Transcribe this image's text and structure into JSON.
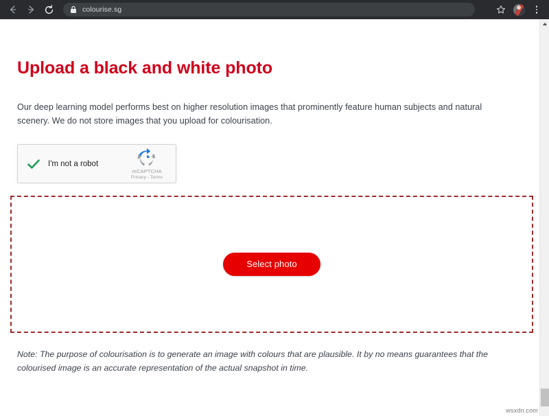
{
  "browser": {
    "back_label": "Back",
    "forward_label": "Forward",
    "reload_label": "Reload",
    "url": "colourise.sg",
    "lock_icon": "lock-icon",
    "bookmark_label": "Bookmark this tab",
    "profile_label": "Profile",
    "menu_label": "Customise and control Google Chrome"
  },
  "page": {
    "title": "Upload a black and white photo",
    "intro": "Our deep learning model performs best on higher resolution images that prominently feature human subjects and natural scenery. We do not store images that you upload for colourisation.",
    "note": "Note: The purpose of colourisation is to generate an image with colours that are plausible. It by no means guarantees that the colourised image is an accurate representation of the actual snapshot in time."
  },
  "recaptcha": {
    "label": "I'm not a robot",
    "brand": "reCAPTCHA",
    "links": "Privacy - Terms",
    "checked": true
  },
  "dropzone": {
    "button_label": "Select photo"
  },
  "watermark": {
    "text": "wsxdn.com"
  },
  "colors": {
    "heading_red": "#d0021b",
    "button_red": "#e60000",
    "dashed_border": "#9e2a2a",
    "body_text": "#39404a",
    "chrome_bg": "#292b2f",
    "omnibox_bg": "#3c4043",
    "check_green": "#1e9e52"
  }
}
